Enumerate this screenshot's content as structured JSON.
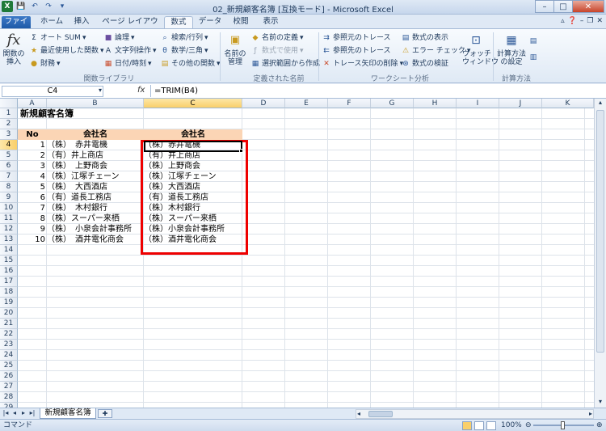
{
  "window": {
    "title": "02_新規顧客名簿 [互換モード] - Microsoft Excel",
    "app_icon": "X",
    "qat": [
      "save-icon",
      "undo-icon",
      "redo-icon",
      "customize-icon"
    ]
  },
  "ribbon_tabs": [
    {
      "label": "ファイル",
      "state": "file"
    },
    {
      "label": "ホーム",
      "state": ""
    },
    {
      "label": "挿入",
      "state": ""
    },
    {
      "label": "ページ レイアウト",
      "state": ""
    },
    {
      "label": "数式",
      "state": "active"
    },
    {
      "label": "データ",
      "state": ""
    },
    {
      "label": "校閲",
      "state": ""
    },
    {
      "label": "表示",
      "state": ""
    }
  ],
  "ribbon": {
    "insert_function": "関数の\n挿入",
    "autosum": "オート SUM",
    "recent": "最近使用した関数",
    "finance": "財務",
    "logical": "論理",
    "text": "文字列操作",
    "datetime": "日付/時刻",
    "lookup": "検索/行列",
    "math": "数学/三角",
    "other": "その他の関数",
    "group_library": "関数ライブラリ",
    "name_manager": "名前の\n管理",
    "define_name": "名前の定義",
    "use_in_formula": "数式で使用",
    "create_from_selection": "選択範囲から作成",
    "group_names": "定義された名前",
    "trace_precedents": "参照元のトレース",
    "trace_dependents": "参照先のトレース",
    "remove_arrows": "トレース矢印の削除",
    "show_formulas": "数式の表示",
    "error_check": "エラー チェック",
    "evaluate": "数式の検証",
    "watch": "ウォッチ\nウィンドウ",
    "group_audit": "ワークシート分析",
    "calc_options": "計算方法\nの設定",
    "group_calc": "計算方法"
  },
  "formula_bar": {
    "name_box": "C4",
    "fx": "fx",
    "formula": "=TRIM(B4)"
  },
  "columns": [
    "A",
    "B",
    "C",
    "D",
    "E",
    "F",
    "G",
    "H",
    "I",
    "J",
    "K"
  ],
  "rows": [
    "1",
    "2",
    "3",
    "4",
    "5",
    "6",
    "7",
    "8",
    "9",
    "10",
    "11",
    "12",
    "13",
    "14",
    "15",
    "16",
    "17",
    "18",
    "19",
    "20",
    "21",
    "22",
    "23",
    "24",
    "25",
    "26",
    "27",
    "28",
    "29"
  ],
  "sheet": {
    "title": "新規顧客名簿",
    "header_no": "No",
    "header_b": "会社名",
    "header_c": "会社名",
    "data": [
      {
        "no": "1",
        "b": "（株）　赤井電機",
        "c": "（株）赤井電機"
      },
      {
        "no": "2",
        "b": "（有）井上商店",
        "c": "（有）井上商店"
      },
      {
        "no": "3",
        "b": "（株）　上野商会",
        "c": "（株）上野商会"
      },
      {
        "no": "4",
        "b": "（株）江塚チェーン",
        "c": "（株）江塚チェーン"
      },
      {
        "no": "5",
        "b": "（株）　大西酒店",
        "c": "（株）大西酒店"
      },
      {
        "no": "6",
        "b": "（有）道長工務店",
        "c": "（有）道長工務店"
      },
      {
        "no": "7",
        "b": "（株）　木村銀行",
        "c": "（株）木村銀行"
      },
      {
        "no": "8",
        "b": "（株）スーパー来栖",
        "c": "（株）スーパー来栖"
      },
      {
        "no": "9",
        "b": "（株）　小泉会計事務所",
        "c": "（株）小泉会計事務所"
      },
      {
        "no": "10",
        "b": "（株）　酒井電化商会",
        "c": "（株）酒井電化商会"
      }
    ]
  },
  "sheet_tabs": {
    "active": "新規顧客名簿"
  },
  "status": {
    "mode": "コマンド",
    "zoom": "100%"
  },
  "colors": {
    "header_fill": "#fbd5b5",
    "highlight": "#ee0000",
    "accent": "#1e5aa8"
  }
}
